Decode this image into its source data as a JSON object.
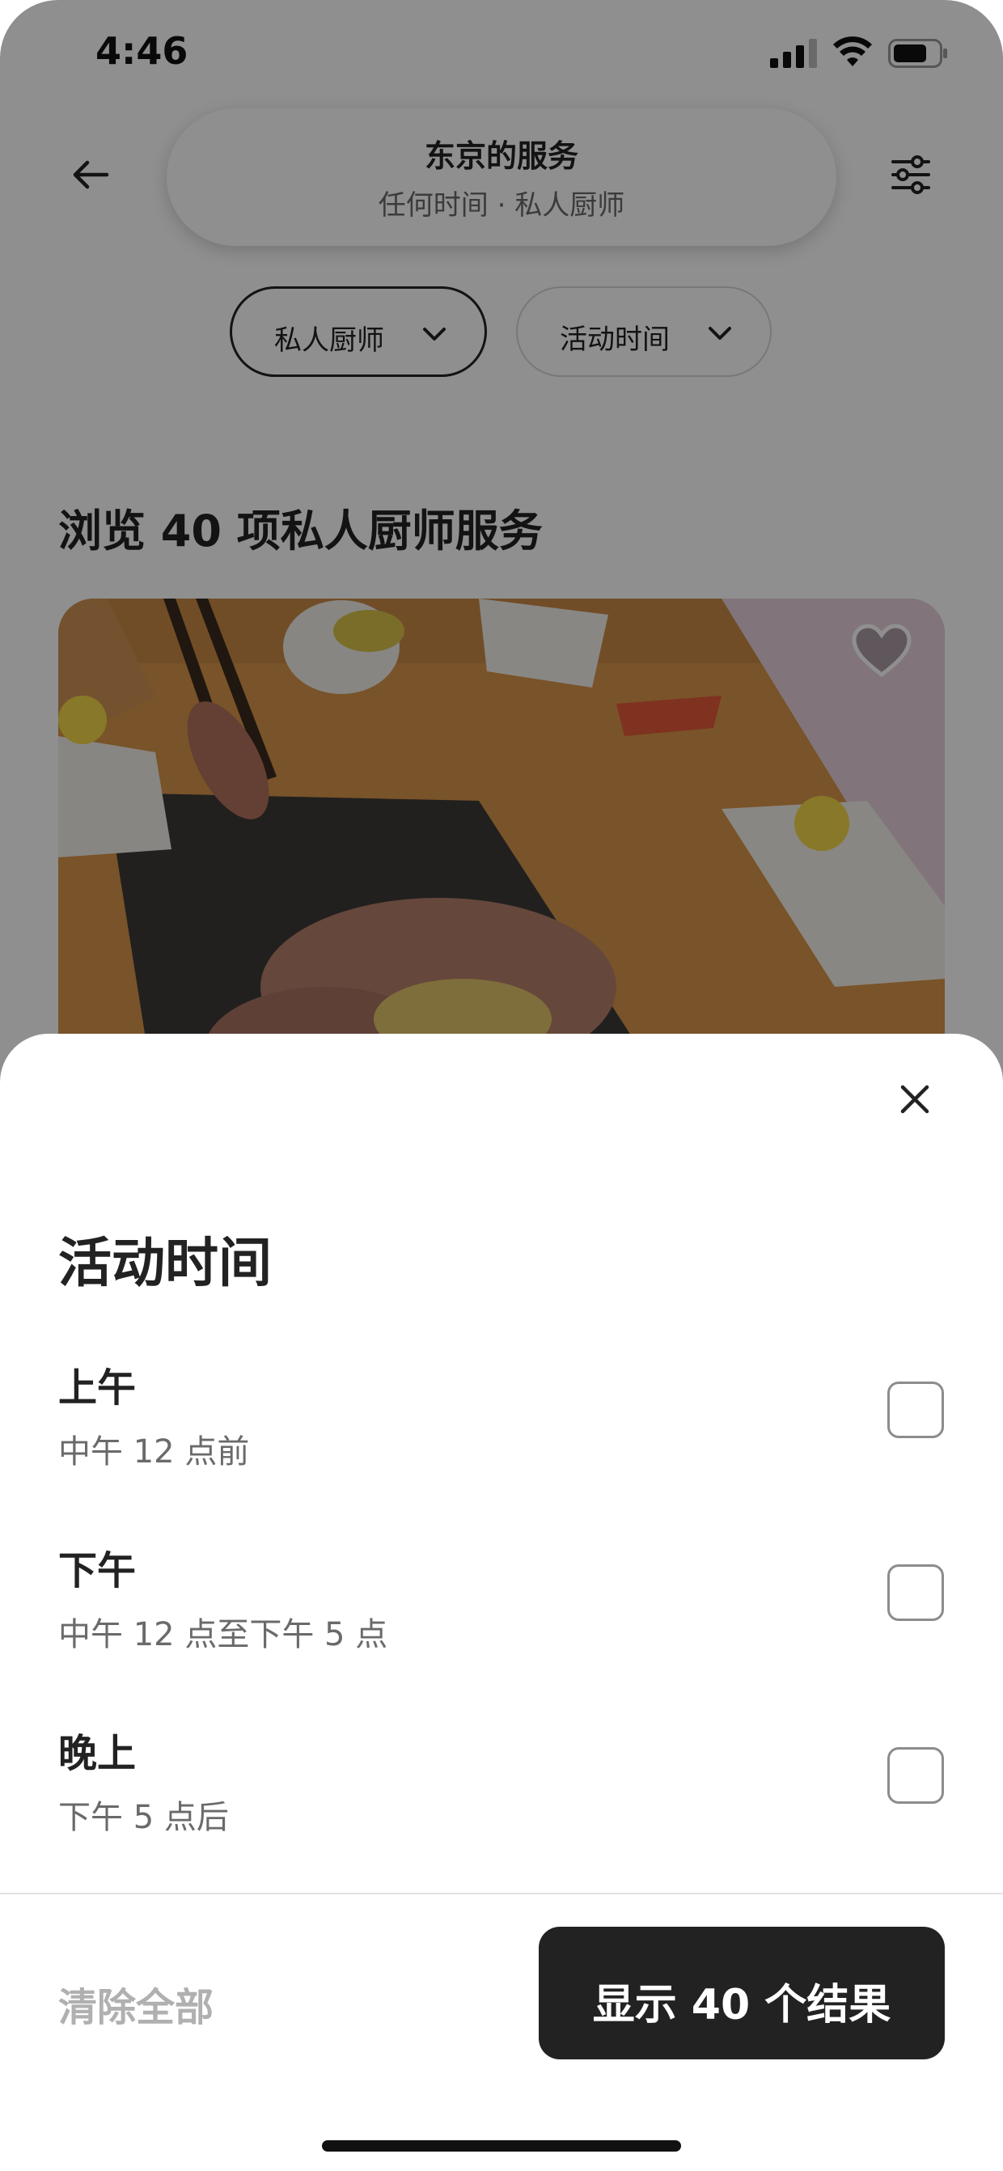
{
  "status_bar": {
    "time": "4:46"
  },
  "header": {
    "title": "东京的服务",
    "subtitle": "任何时间 · 私人厨师"
  },
  "chips": [
    {
      "label": "私人厨师",
      "selected": true
    },
    {
      "label": "活动时间",
      "selected": false
    }
  ],
  "browse_heading": "浏览 40 项私人厨师服务",
  "sheet": {
    "title": "活动时间",
    "options": [
      {
        "title": "上午",
        "subtitle": "中午 12 点前",
        "checked": false
      },
      {
        "title": "下午",
        "subtitle": "中午 12 点至下午 5 点",
        "checked": false
      },
      {
        "title": "晚上",
        "subtitle": "下午 5 点后",
        "checked": false
      }
    ],
    "clear_label": "清除全部",
    "show_label": "显示 40 个结果"
  },
  "icons": {
    "back": "back-arrow-icon",
    "filters": "sliders-icon",
    "favorite": "heart-icon",
    "close": "close-icon",
    "chevron": "chevron-down-icon"
  },
  "colors": {
    "primary_button": "#222222",
    "disabled_text": "#b0b0b0",
    "scrim": "rgba(0,0,0,0.44)"
  }
}
